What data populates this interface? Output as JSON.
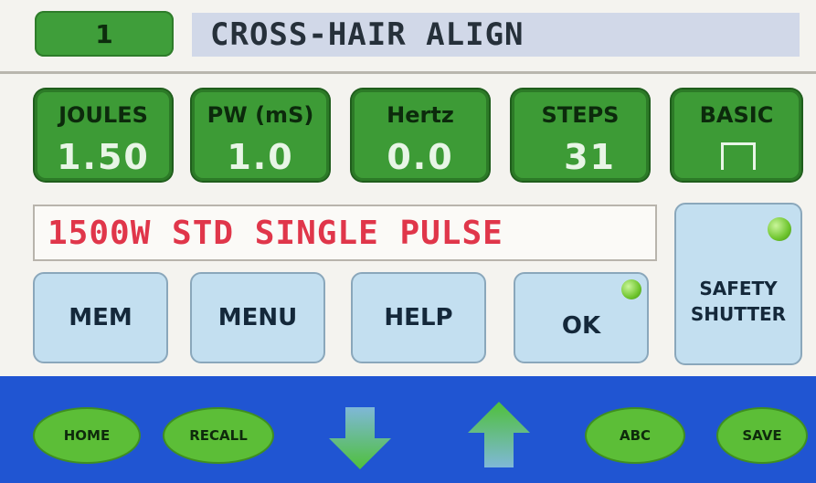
{
  "header": {
    "program_number": "1",
    "title": "CROSS-HAIR ALIGN"
  },
  "params": [
    {
      "label": "JOULES",
      "value": "1.50"
    },
    {
      "label": "PW (mS)",
      "value": "1.0"
    },
    {
      "label": "Hertz",
      "value": "0.0"
    },
    {
      "label": "STEPS",
      "value": "31"
    }
  ],
  "basic": {
    "label": "BASIC",
    "icon": "square-pulse-icon"
  },
  "mode_line": "1500W STD SINGLE PULSE",
  "buttons": {
    "mem": "MEM",
    "menu": "MENU",
    "help": "HELP",
    "ok": "OK"
  },
  "safety_shutter": {
    "line1": "SAFETY",
    "line2": "SHUTTER"
  },
  "nav": {
    "home": "HOME",
    "recall": "RECALL",
    "down_icon": "arrow-down-icon",
    "up_icon": "arrow-up-icon",
    "abc": "ABC",
    "save": "SAVE"
  },
  "colors": {
    "param_green": "#3d9b36",
    "button_blue": "#c3dff0",
    "bar_blue": "#2055d2",
    "mode_text_red": "#e0364a",
    "led_green": "#6fc52e"
  }
}
